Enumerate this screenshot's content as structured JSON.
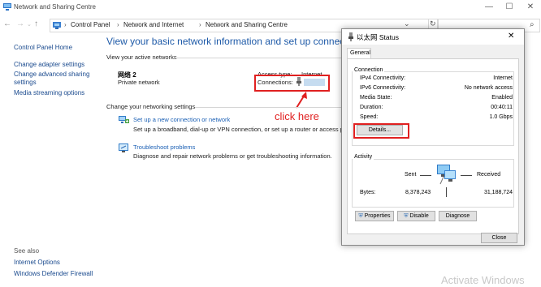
{
  "window": {
    "title": "Network and Sharing Centre",
    "minimize": "—",
    "maximize": "☐",
    "close": "✕"
  },
  "nav": {
    "back": "←",
    "forward": "→",
    "up": "↑",
    "crumbs": [
      "Control Panel",
      "Network and Internet",
      "Network and Sharing Centre"
    ],
    "sep": "›",
    "dropdown": "⌄",
    "refresh": "↻",
    "search_placeholder": "",
    "search_icon": "⌕"
  },
  "sidebar": {
    "items": [
      "Control Panel Home",
      "Change adapter settings",
      "Change advanced sharing settings",
      "Media streaming options"
    ],
    "see_also": "See also",
    "bottom_items": [
      "Internet Options",
      "Windows Defender Firewall"
    ]
  },
  "main": {
    "heading": "View your basic network information and set up connections",
    "active_networks": "View your active networks",
    "network_name": "网络 2",
    "network_type": "Private network",
    "access_type_label": "Access type:",
    "access_type_value": "Internet",
    "connections_label": "Connections:",
    "change_settings": "Change your networking settings",
    "setup_link": "Set up a new connection or network",
    "setup_desc": "Set up a broadband, dial-up or VPN connection, or set up a router or access point.",
    "troubleshoot_link": "Troubleshoot problems",
    "troubleshoot_desc": "Diagnose and repair network problems or get troubleshooting information.",
    "annotation": "click here"
  },
  "dialog": {
    "title": "以太网 Status",
    "close": "✕",
    "tab": "General",
    "connection_group": "Connection",
    "rows": [
      {
        "label": "IPv4 Connectivity:",
        "value": "Internet"
      },
      {
        "label": "IPv6 Connectivity:",
        "value": "No network access"
      },
      {
        "label": "Media State:",
        "value": "Enabled"
      },
      {
        "label": "Duration:",
        "value": "00:40:11"
      },
      {
        "label": "Speed:",
        "value": "1.0 Gbps"
      }
    ],
    "details_btn": "Details...",
    "activity_group": "Activity",
    "sent": "Sent",
    "received": "Received",
    "bytes_label": "Bytes:",
    "bytes_sent": "8,378,243",
    "bytes_received": "31,188,724",
    "properties_btn": "Properties",
    "disable_btn": "Disable",
    "diagnose_btn": "Diagnose",
    "close_btn": "Close"
  },
  "watermark": "Activate Windows",
  "colors": {
    "accent": "#1e5aa8",
    "annotation": "#e02020"
  }
}
